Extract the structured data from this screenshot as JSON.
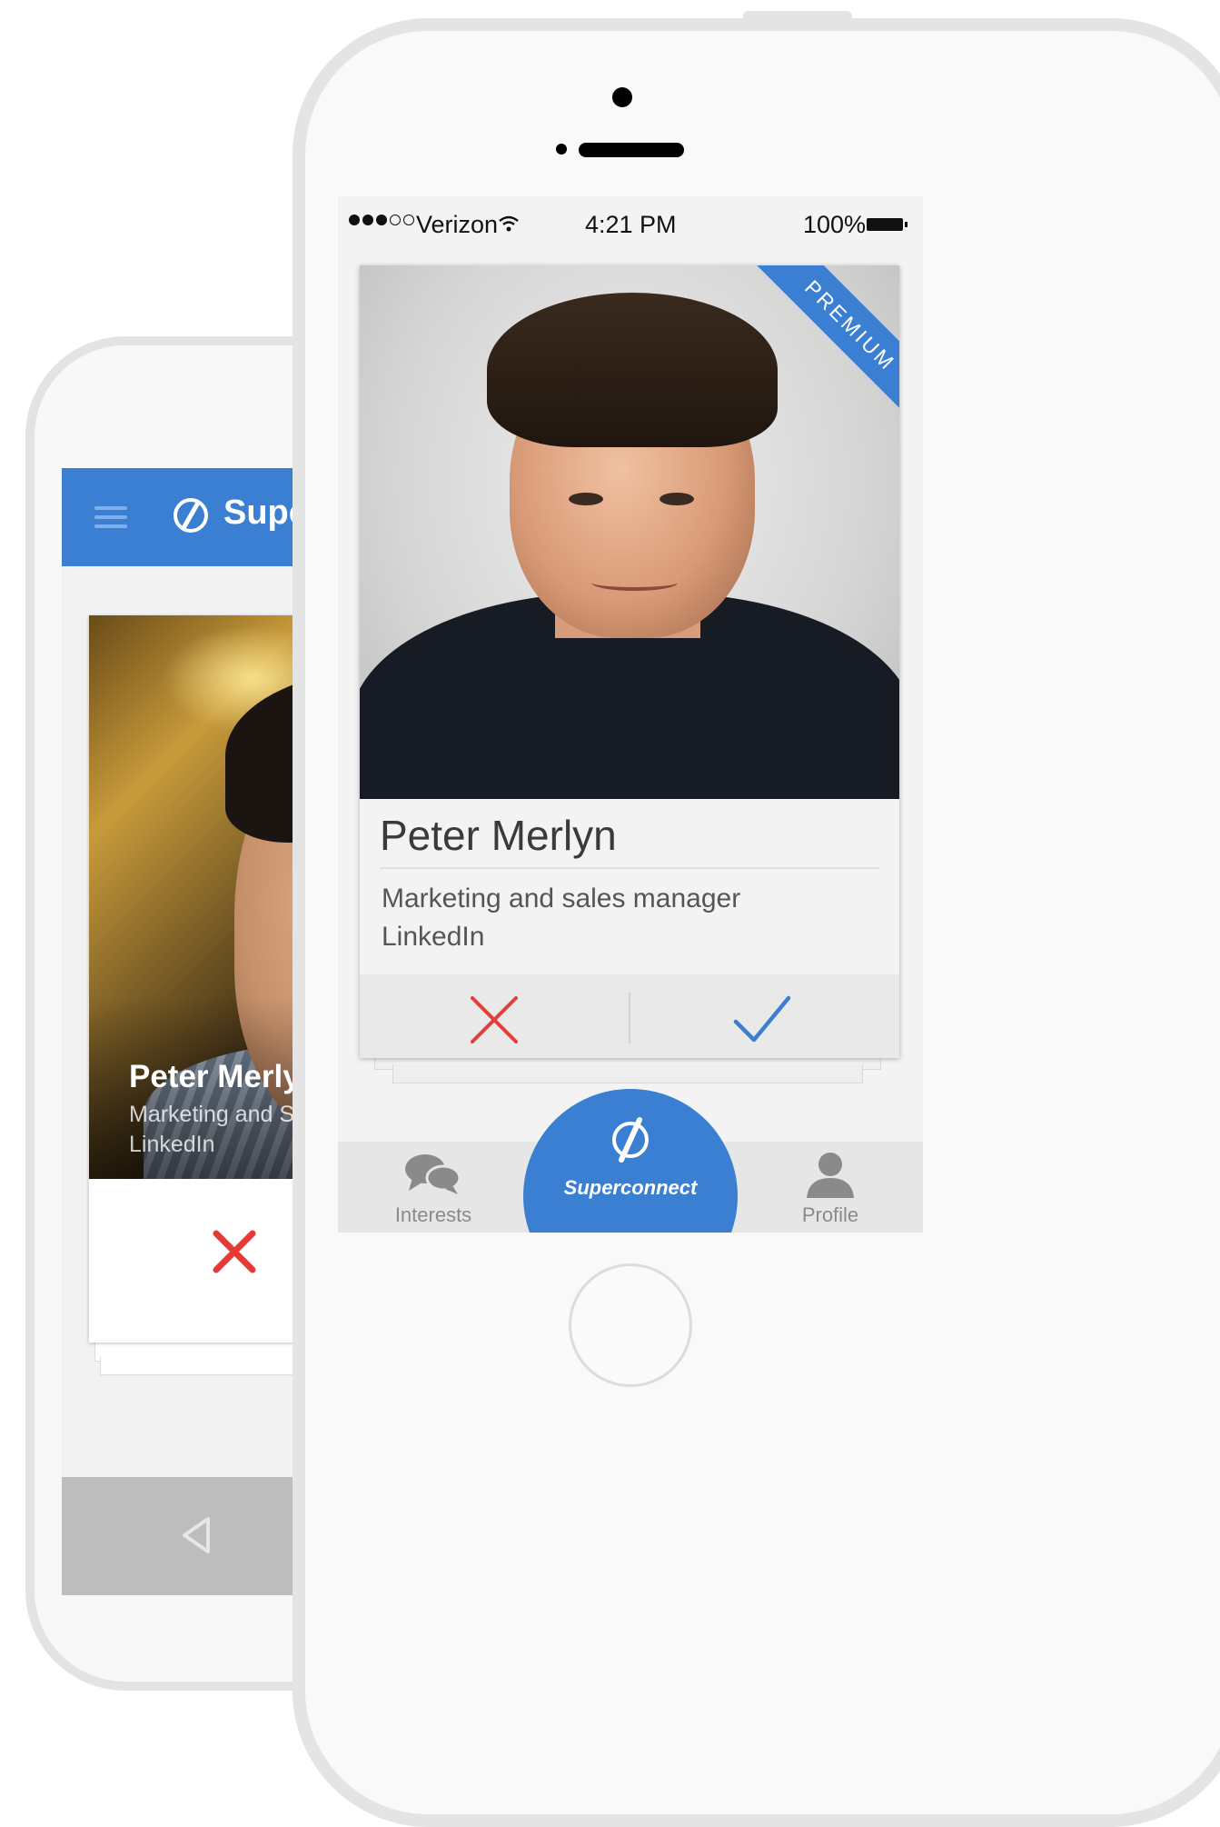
{
  "back_phone": {
    "app_title": "SuperConn",
    "card": {
      "name": "Peter Merlyn",
      "job": "Marketing and Sales M",
      "company": "LinkedIn"
    },
    "icons": {
      "menu": "hamburger-icon",
      "logo": "superconnect-logo-icon",
      "reject": "close-icon",
      "nav_back": "back-triangle-icon",
      "nav_home": "home-circle-icon"
    }
  },
  "front_phone": {
    "status_bar": {
      "carrier": "Verizon",
      "time": "4:21 PM",
      "battery": "100%"
    },
    "card": {
      "badge": "PREMIUM",
      "name": "Peter Merlyn",
      "job": "Marketing and sales manager",
      "company": "LinkedIn"
    },
    "tabs": {
      "interests": "Interests",
      "superconnect": "Superconnect",
      "profile": "Profile"
    },
    "icons": {
      "reject": "close-icon",
      "accept": "check-icon",
      "interests": "chat-bubbles-icon",
      "superconnect": "superconnect-logo-icon",
      "profile": "person-icon"
    }
  },
  "colors": {
    "brand_blue": "#3b7fd3",
    "reject_red": "#e0403a",
    "accept_blue": "#3b7fd3"
  }
}
